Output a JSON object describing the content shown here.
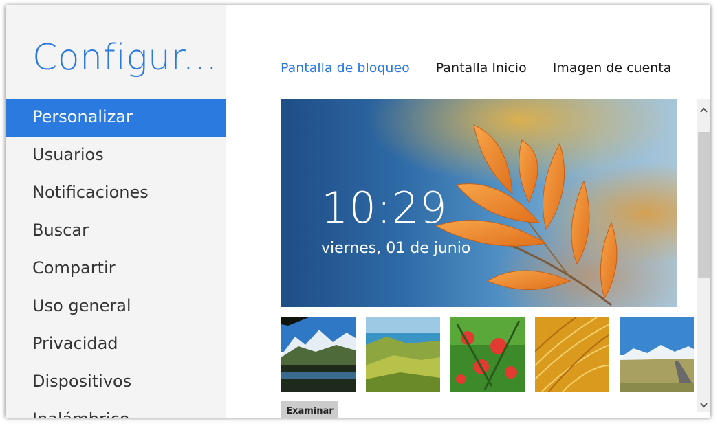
{
  "sidebar": {
    "title": "Configur...",
    "items": [
      {
        "label": "Personalizar"
      },
      {
        "label": "Usuarios"
      },
      {
        "label": "Notificaciones"
      },
      {
        "label": "Buscar"
      },
      {
        "label": "Compartir"
      },
      {
        "label": "Uso general"
      },
      {
        "label": "Privacidad"
      },
      {
        "label": "Dispositivos"
      },
      {
        "label": "Inalámbrico"
      }
    ],
    "active_item": "Personalizar"
  },
  "main": {
    "tabs": [
      {
        "label": "Pantalla de bloqueo"
      },
      {
        "label": "Pantalla Inicio"
      },
      {
        "label": "Imagen de cuenta"
      }
    ],
    "active_tab": "Pantalla de bloqueo",
    "lock_preview": {
      "time": "10:29",
      "date": "viernes, 01 de junio"
    },
    "thumbnails": [
      {
        "subject": "mountain-lake"
      },
      {
        "subject": "green-hills-coast"
      },
      {
        "subject": "red-flowers"
      },
      {
        "subject": "golden-grass"
      },
      {
        "subject": "mountain-road"
      }
    ],
    "browse_label": "Examinar"
  },
  "colors": {
    "accent": "#2a7ae0",
    "sidebar_bg": "#f4f4f4",
    "text": "#333333"
  },
  "icons": {
    "scroll_up": "chevron-up-icon",
    "scroll_down": "chevron-down-icon"
  }
}
